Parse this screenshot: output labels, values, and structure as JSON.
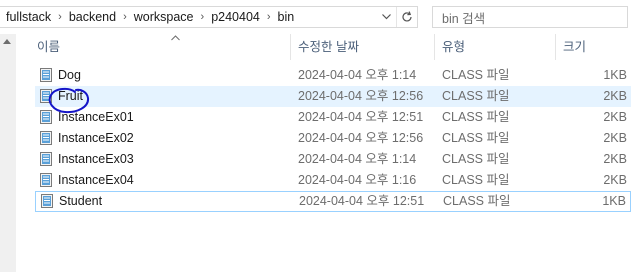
{
  "address_bar": {
    "crumbs": [
      "fullstack",
      "backend",
      "workspace",
      "p240404",
      "bin"
    ],
    "separator": "›"
  },
  "search": {
    "placeholder": "bin 검색"
  },
  "columns": {
    "name": "이름",
    "date": "수정한 날짜",
    "type": "유형",
    "size": "크기"
  },
  "files": [
    {
      "name": "Dog",
      "date": "2024-04-04 오후 1:14",
      "type": "CLASS 파일",
      "size": "1KB"
    },
    {
      "name": "Fruit",
      "date": "2024-04-04 오후 12:56",
      "type": "CLASS 파일",
      "size": "2KB"
    },
    {
      "name": "InstanceEx01",
      "date": "2024-04-04 오후 12:51",
      "type": "CLASS 파일",
      "size": "2KB"
    },
    {
      "name": "InstanceEx02",
      "date": "2024-04-04 오후 12:56",
      "type": "CLASS 파일",
      "size": "2KB"
    },
    {
      "name": "InstanceEx03",
      "date": "2024-04-04 오후 1:14",
      "type": "CLASS 파일",
      "size": "2KB"
    },
    {
      "name": "InstanceEx04",
      "date": "2024-04-04 오후 1:16",
      "type": "CLASS 파일",
      "size": "2KB"
    },
    {
      "name": "Student",
      "date": "2024-04-04 오후 12:51",
      "type": "CLASS 파일",
      "size": "1KB"
    }
  ],
  "icons": {
    "file": "class-file-icon",
    "refresh": "refresh-icon",
    "dropdown": "chevron-down-icon",
    "sort": "sort-ascending-icon"
  },
  "colors": {
    "hover_row": "#e5f3ff",
    "selected_border": "#99d1ff",
    "header_text": "#4c607a",
    "annotation": "#1515c8"
  }
}
